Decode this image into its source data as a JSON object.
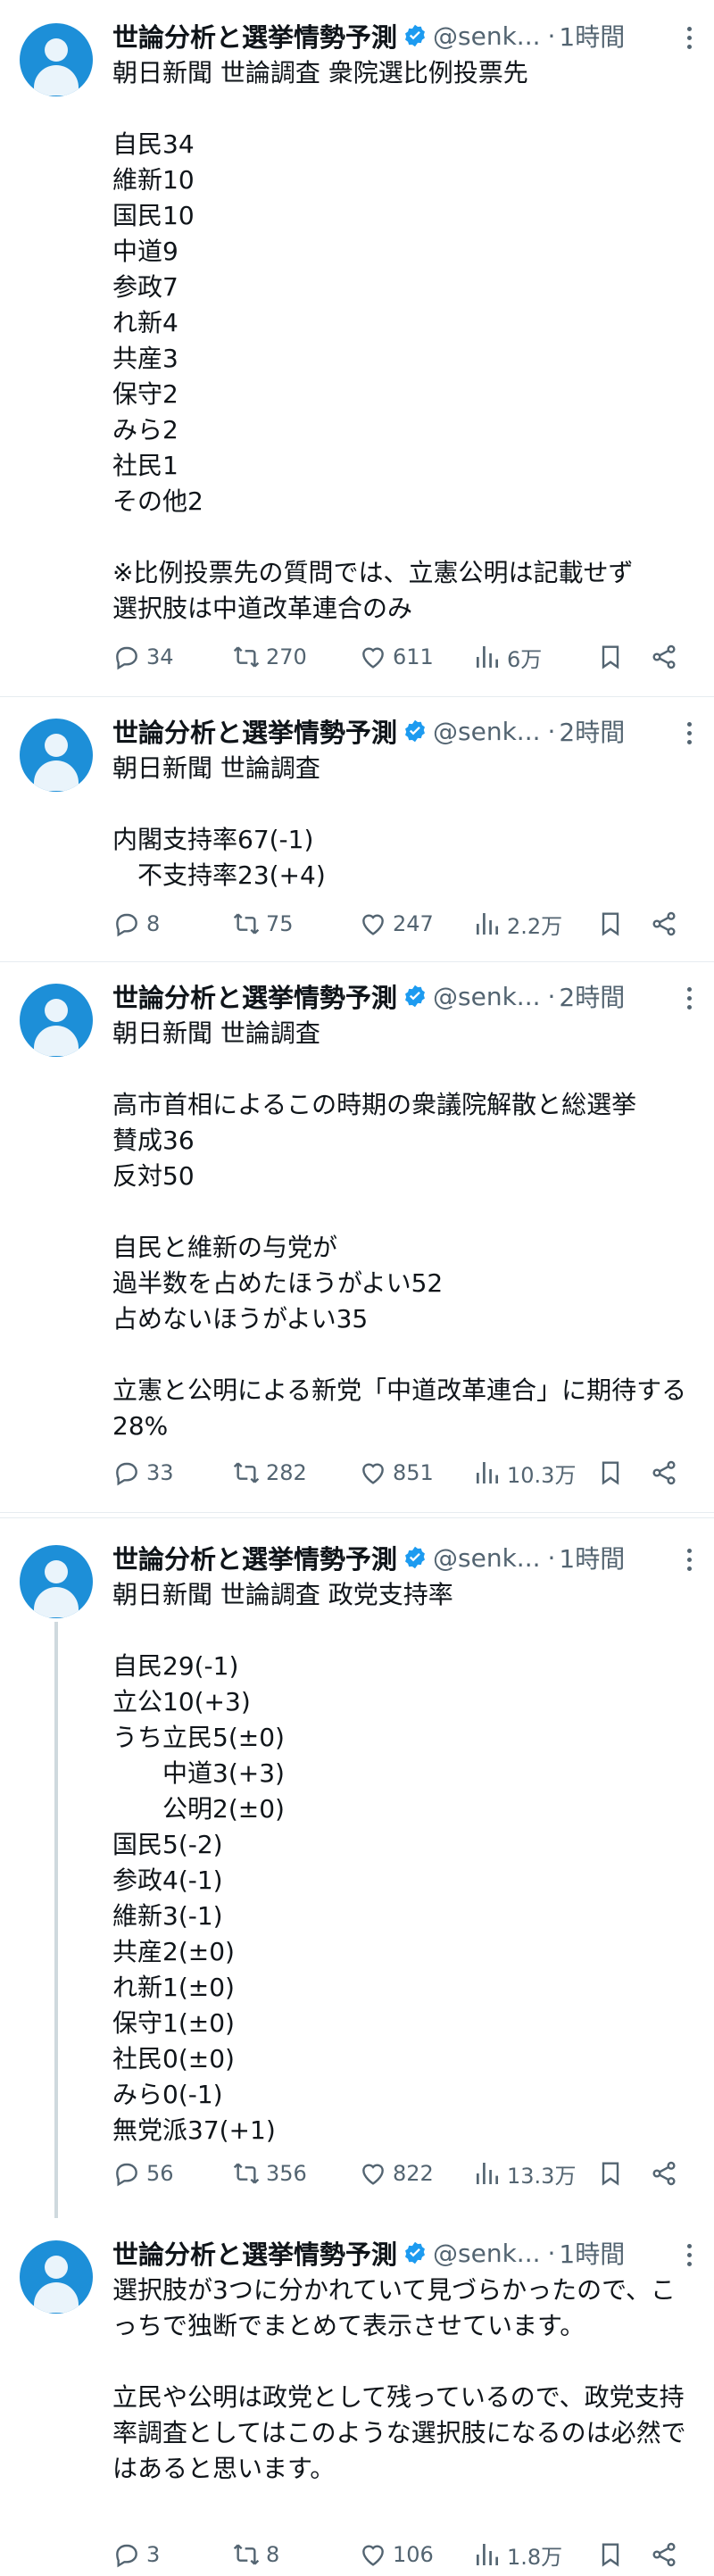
{
  "tweets": [
    {
      "name": "世論分析と選挙情勢予測",
      "handle": "@senk...",
      "time": "1時間",
      "text": "朝日新聞 世論調査 衆院選比例投票先\n\n自民34\n維新10\n国民10\n中道9\n参政7\nれ新4\n共産3\n保守2\nみら2\n社民1\nその他2\n\n※比例投票先の質問では、立憲公明は記載せず\n選択肢は中道改革連合のみ",
      "replies": "34",
      "retweets": "270",
      "likes": "611",
      "views": "6万"
    },
    {
      "name": "世論分析と選挙情勢予測",
      "handle": "@senk...",
      "time": "2時間",
      "text": "朝日新聞 世論調査\n\n内閣支持率67(-1)\n　不支持率23(+4)",
      "replies": "8",
      "retweets": "75",
      "likes": "247",
      "views": "2.2万"
    },
    {
      "name": "世論分析と選挙情勢予測",
      "handle": "@senk...",
      "time": "2時間",
      "text": "朝日新聞 世論調査\n\n高市首相によるこの時期の衆議院解散と総選挙\n賛成36\n反対50\n\n自民と維新の与党が\n過半数を占めたほうがよい52\n占めないほうがよい35\n\n立憲と公明による新党「中道改革連合」に期待する28%",
      "replies": "33",
      "retweets": "282",
      "likes": "851",
      "views": "10.3万"
    },
    {
      "name": "世論分析と選挙情勢予測",
      "handle": "@senk...",
      "time": "1時間",
      "text": "朝日新聞 世論調査 政党支持率\n\n自民29(-1)\n立公10(+3)\nうち立民5(±0)\n　　中道3(+3)\n　　公明2(±0)\n国民5(-2)\n参政4(-1)\n維新3(-1)\n共産2(±0)\nれ新1(±0)\n保守1(±0)\n社民0(±0)\nみら0(-1)\n無党派37(+1)",
      "replies": "56",
      "retweets": "356",
      "likes": "822",
      "views": "13.3万"
    },
    {
      "name": "世論分析と選挙情勢予測",
      "handle": "@senk...",
      "time": "1時間",
      "text": "選択肢が3つに分かれていて見づらかったので、こっちで独断でまとめて表示させています。\n\n立民や公明は政党として残っているので、政党支持率調査としてはこのような選択肢になるのは必然ではあると思います。",
      "replies": "3",
      "retweets": "8",
      "likes": "106",
      "views": "1.8万"
    }
  ],
  "separator": "·",
  "colors": {
    "verified": "#1d9bf0",
    "avatar": "#1d8fd8",
    "muted": "#536471",
    "thread_line": "#cfd9de"
  },
  "icons": [
    "reply-icon",
    "retweet-icon",
    "like-icon",
    "views-icon",
    "bookmark-icon",
    "share-icon",
    "more-icon",
    "verified-icon"
  ]
}
